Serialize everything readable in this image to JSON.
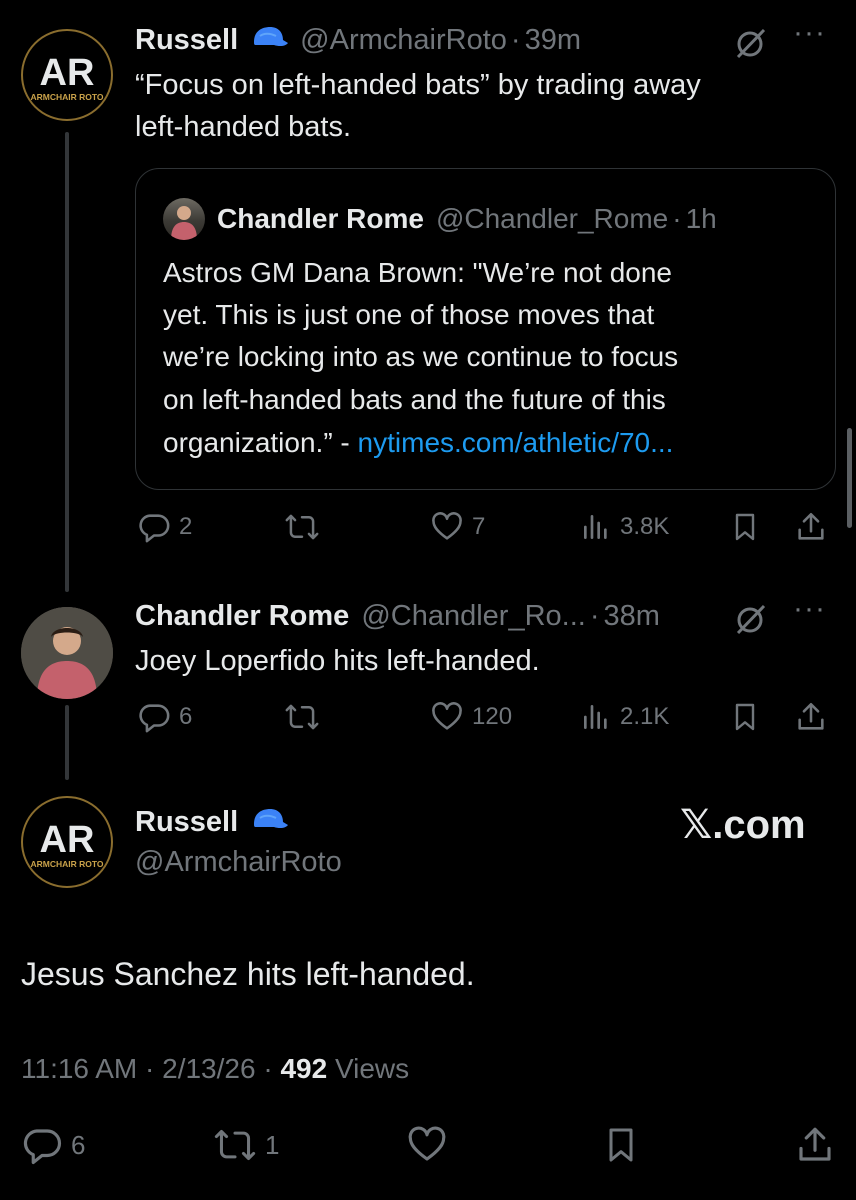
{
  "tweet1": {
    "author_name": "Russell",
    "handle": "@ArmchairRoto",
    "time": "39m",
    "text_line1": "“Focus on left-handed bats” by trading away",
    "text_line2": "left-handed bats.",
    "avatar_icon": "armchair-roto-logo",
    "quote": {
      "author_name": "Chandler Rome",
      "handle": "@Chandler_Rome",
      "time": "1h",
      "lines": [
        "Astros GM Dana Brown: \"We’re not done",
        "yet. This is just one of those moves that",
        "we’re locking into as we continue to focus",
        "on left-handed bats and the future of this"
      ],
      "last_line_prefix": "organization.” - ",
      "link": "nytimes.com/athletic/70..."
    },
    "actions": {
      "replies": "2",
      "reposts": "",
      "likes": "7",
      "views": "3.8K"
    }
  },
  "tweet2": {
    "author_name": "Chandler Rome",
    "handle": "@Chandler_Ro...",
    "time": "38m",
    "text": "Joey Loperfido hits left-handed.",
    "actions": {
      "replies": "6",
      "reposts": "",
      "likes": "120",
      "views": "2.1K"
    }
  },
  "main": {
    "author_name": "Russell",
    "handle": "@ArmchairRoto",
    "brand": "𝕏.com",
    "text": "Jesus Sanchez hits left-handed.",
    "time": "11:16 AM",
    "date": "2/13/26",
    "views_count": "492",
    "views_label": "Views",
    "actions": {
      "replies": "6",
      "reposts": "1"
    }
  },
  "logo_text": {
    "letters": "AR",
    "subtitle": "ARMCHAIR ROTO"
  },
  "separator": "·",
  "colors": {
    "background": "#000000",
    "text": "#e7e9ea",
    "muted": "#71767b",
    "link": "#1d9bf0",
    "cap": "#3b82f6",
    "logo_gold": "#c9a24a"
  }
}
